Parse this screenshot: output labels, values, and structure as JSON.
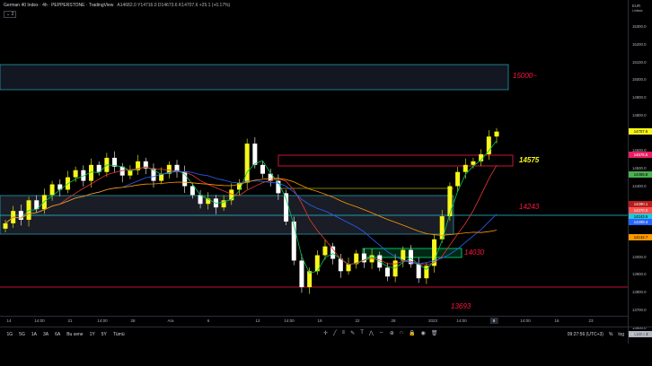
{
  "legend": {
    "title": "German 40 Index · 4h · PEPPERSTONE · TradingView",
    "ohlc": "A14682.0 Y14716.0 D14673.6 K14707.6 +25.1 (+0.17%)",
    "collapse": "2"
  },
  "price_axis": {
    "currency": "EUR",
    "sub": "Limitsiz",
    "ticks": [
      "15300.0",
      "15200.0",
      "15100.0",
      "15000.0",
      "14900.0",
      "14800.0",
      "14600.0",
      "14500.0",
      "14400.0",
      "14200.0",
      "14000.0",
      "13900.0",
      "13800.0",
      "13700.0",
      "13600.0"
    ],
    "tags": [
      {
        "text": "14707.6",
        "bg": "#f7f719",
        "fg": "#000"
      },
      {
        "text": "14576.5",
        "bg": "#e91e63",
        "fg": "#fff"
      },
      {
        "text": "14465.8",
        "bg": "#4caf50",
        "fg": "#000"
      },
      {
        "text": "14290.1",
        "bg": "#b71c1c",
        "fg": "#fff"
      },
      {
        "text": "14270.0",
        "bg": "#ff5252",
        "fg": "#fff"
      },
      {
        "text": "14243.6",
        "bg": "#26c6da",
        "fg": "#000"
      },
      {
        "text": "14208.4",
        "bg": "#2962ff",
        "fg": "#fff"
      },
      {
        "text": "14142.7",
        "bg": "#ff9800",
        "fg": "#000"
      },
      {
        "text": "13693.4",
        "bg": "#b2b5be",
        "fg": "#000"
      }
    ]
  },
  "annotations": {
    "level_15000": "15000~",
    "level_14575": "14575",
    "level_14243": "14243",
    "level_14030": "14030",
    "level_13693": "13693"
  },
  "time_axis": {
    "labels": [
      "14",
      "14:00",
      "21",
      "14:00",
      "28",
      "Ara",
      "6",
      "12",
      "14:00",
      "19",
      "22",
      "28",
      "2023",
      "14:00",
      "9",
      "14:00",
      "16",
      "23"
    ],
    "current": "9"
  },
  "bottom_bar": {
    "ranges": [
      "1G",
      "5G",
      "1A",
      "3A",
      "6A",
      "Bu sene",
      "1Y",
      "5Y",
      "Tümü"
    ],
    "clock": "09:27:56 (UTC+3)",
    "percent": "%",
    "log": "log",
    "auto": "otomatik"
  },
  "colors": {
    "up": "#f7f719",
    "down": "#ffffff",
    "box_border": "#26c6da",
    "line_14243": "#26c6da",
    "line_13693": "#ff1744",
    "box_14575": "#ff1744",
    "box_14030": "#00e676",
    "ma_green": "#00c853",
    "ma_red": "#e53935",
    "ma_blue": "#2962ff",
    "ma_orange": "#ff9800"
  },
  "chart_data": {
    "type": "line",
    "symbol": "German 40 Index",
    "interval": "4h",
    "key_levels": [
      15000,
      14575,
      14243,
      14030,
      13693
    ],
    "ylim": [
      13600,
      15350
    ],
    "close_path": [
      14190,
      14260,
      14210,
      14320,
      14270,
      14350,
      14410,
      14380,
      14450,
      14490,
      14430,
      14520,
      14480,
      14560,
      14510,
      14460,
      14490,
      14540,
      14500,
      14430,
      14470,
      14520,
      14480,
      14400,
      14350,
      14300,
      14330,
      14280,
      14320,
      14380,
      14420,
      14640,
      14520,
      14470,
      14430,
      14360,
      14200,
      13980,
      13830,
      13920,
      14010,
      14060,
      13990,
      13920,
      13960,
      14020,
      13970,
      14010,
      13940,
      13890,
      13980,
      14040,
      13960,
      13880,
      13950,
      14100,
      14230,
      14400,
      14480,
      14520,
      14540,
      14580,
      14680,
      14708
    ]
  }
}
